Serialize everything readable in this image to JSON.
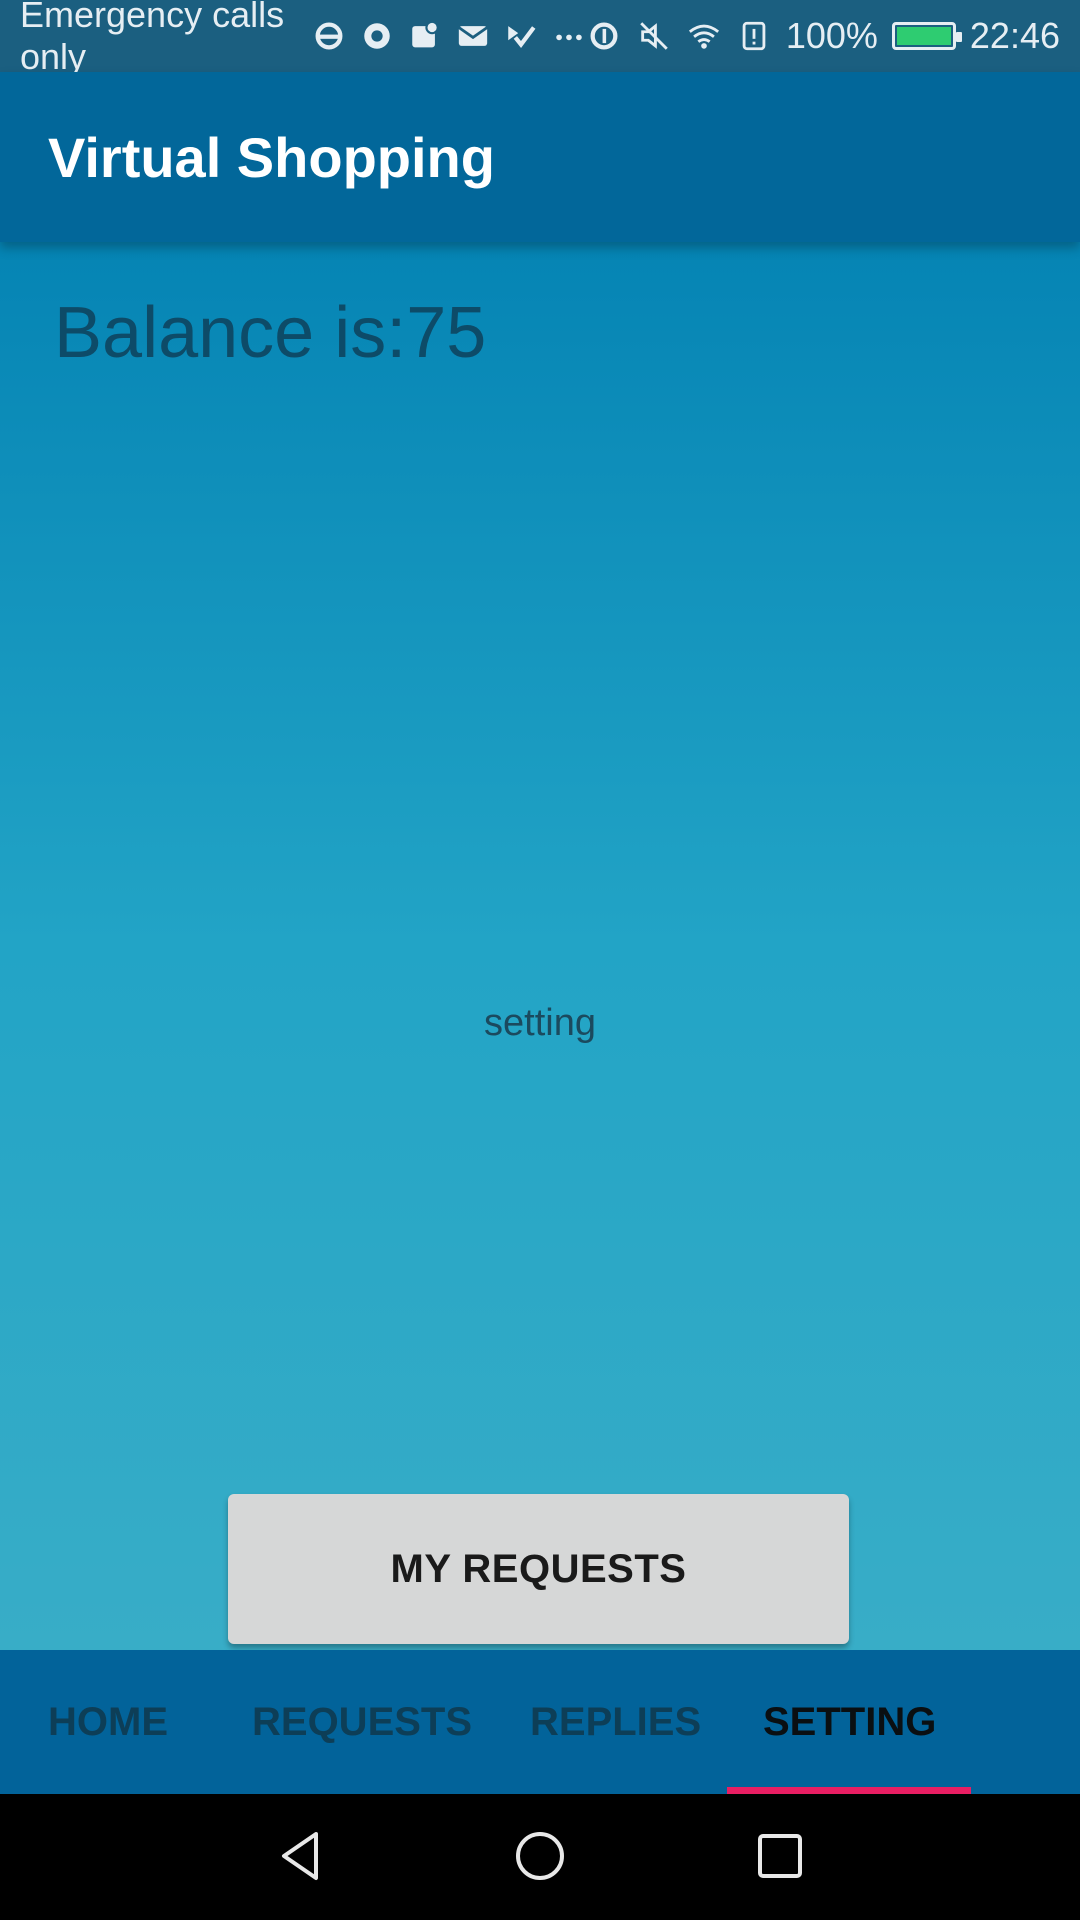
{
  "status_bar": {
    "carrier_text": "Emergency calls only",
    "battery_percent": "100%",
    "battery_level": 1.0,
    "time": "22:46",
    "icons": [
      "ie-icon",
      "chrome-icon",
      "maps-icon",
      "gmail-icon",
      "check-icon",
      "more-icon",
      "data-saver-icon",
      "mute-icon",
      "wifi-icon",
      "alert-icon",
      "battery-icon"
    ]
  },
  "app_bar": {
    "title": "Virtual Shopping"
  },
  "main": {
    "balance_text": "Balance is:75",
    "page_label": "setting",
    "my_requests_button": "MY REQUESTS"
  },
  "tabs": [
    {
      "label": "HOME",
      "active": false
    },
    {
      "label": "REQUESTS",
      "active": false
    },
    {
      "label": "REPLIES",
      "active": false
    },
    {
      "label": "SETTING",
      "active": true
    }
  ],
  "colors": {
    "status_bar": "#1b5f80",
    "app_bar": "#02679a",
    "tab_bar": "#02639a",
    "tab_indicator": "#e91e63",
    "button_bg": "#d6d7d7"
  },
  "nav_bar": {
    "icons": [
      "back-icon",
      "home-icon",
      "recents-icon"
    ]
  }
}
